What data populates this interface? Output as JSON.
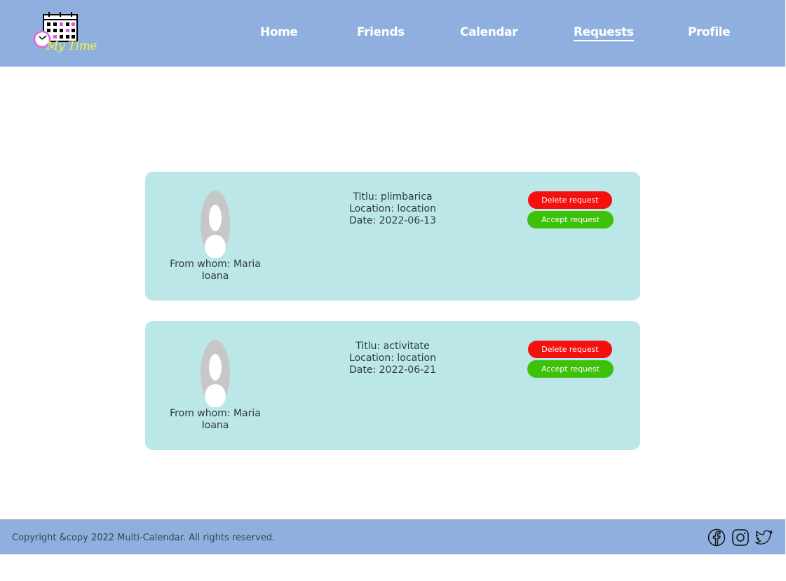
{
  "header": {
    "logo_text": "My Time",
    "nav": [
      {
        "label": "Home"
      },
      {
        "label": "Friends"
      },
      {
        "label": "Calendar"
      },
      {
        "label": "Requests"
      },
      {
        "label": "Profile"
      }
    ],
    "active_nav": "Requests"
  },
  "requests": [
    {
      "from": "From whom: Maria Ioana",
      "title": "Titlu: plimbarica",
      "location": "Location: location",
      "date": "Date: 2022-06-13",
      "delete_label": "Delete request",
      "accept_label": "Accept request"
    },
    {
      "from": "From whom: Maria Ioana",
      "title": "Titlu: activitate",
      "location": "Location: location",
      "date": "Date: 2022-06-21",
      "delete_label": "Delete request",
      "accept_label": "Accept request"
    }
  ],
  "footer": {
    "copyright": "Copyright &copy 2022 Multi-Calendar. All rights reserved.",
    "social_icons": [
      "facebook-icon",
      "instagram-icon",
      "twitter-icon"
    ]
  },
  "colors": {
    "header_bg": "#8fb0df",
    "card_bg": "#bce7e9",
    "delete_btn": "#f51010",
    "accept_btn": "#3dc10b"
  }
}
